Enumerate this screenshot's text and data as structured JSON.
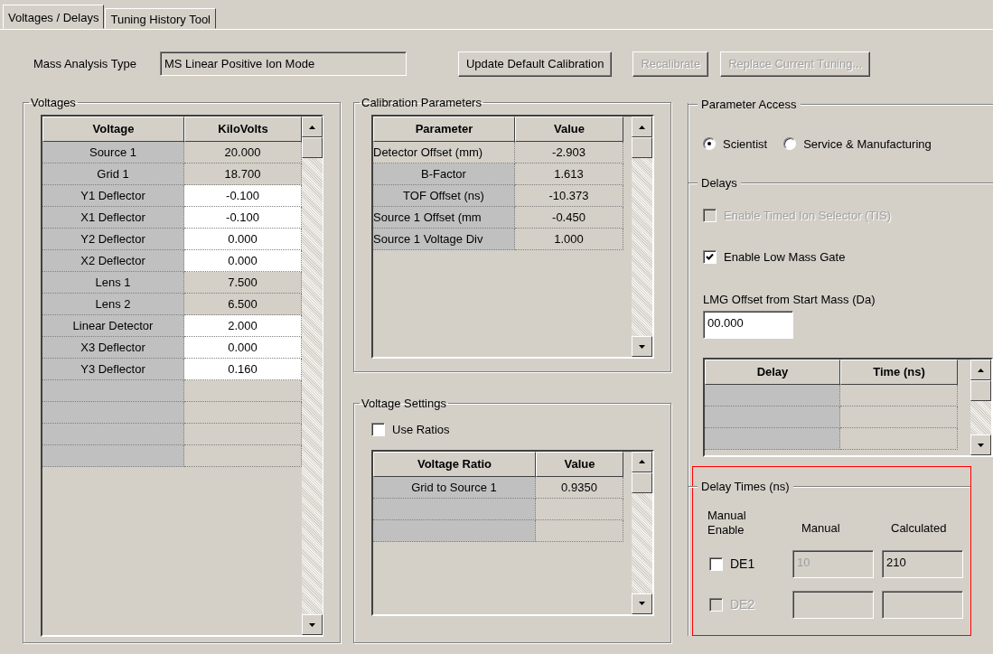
{
  "tabs": [
    {
      "label": "Voltages / Delays",
      "selected": true
    },
    {
      "label": "Tuning History Tool",
      "selected": false
    }
  ],
  "mass_analysis": {
    "label": "Mass Analysis Type",
    "value": "MS Linear Positive Ion Mode"
  },
  "buttons": [
    {
      "label": "Update Default Calibration",
      "disabled": false
    },
    {
      "label": "Recalibrate",
      "disabled": true
    },
    {
      "label": "Replace Current Tuning...",
      "disabled": true
    }
  ],
  "voltages": {
    "title": "Voltages",
    "columns": [
      "Voltage",
      "KiloVolts"
    ],
    "rows": [
      {
        "kind": "entry",
        "name": "Source 1",
        "value": "20.000",
        "editable": false
      },
      {
        "kind": "entry",
        "name": "Grid 1",
        "value": "18.700",
        "editable": false
      },
      {
        "kind": "entry",
        "name": "Y1 Deflector",
        "value": "-0.100",
        "editable": true
      },
      {
        "kind": "entry",
        "name": "X1 Deflector",
        "value": "-0.100",
        "editable": true
      },
      {
        "kind": "entry",
        "name": "Y2 Deflector",
        "value": "0.000",
        "editable": true
      },
      {
        "kind": "entry",
        "name": "X2 Deflector",
        "value": "0.000",
        "editable": true
      },
      {
        "kind": "entry",
        "name": "Lens 1",
        "value": "7.500",
        "editable": false
      },
      {
        "kind": "entry",
        "name": "Lens 2",
        "value": "6.500",
        "editable": false
      },
      {
        "kind": "entry",
        "name": "Linear Detector",
        "value": "2.000",
        "editable": true
      },
      {
        "kind": "entry",
        "name": "X3 Deflector",
        "value": "0.000",
        "editable": true
      },
      {
        "kind": "entry",
        "name": "Y3 Deflector",
        "value": "0.160",
        "editable": true
      },
      {
        "kind": "empty"
      },
      {
        "kind": "empty"
      },
      {
        "kind": "empty"
      },
      {
        "kind": "empty"
      }
    ]
  },
  "calibration": {
    "title": "Calibration Parameters",
    "columns": [
      "Parameter",
      "Value"
    ],
    "rows": [
      {
        "kind": "entry",
        "name": "Detector Offset (mm)",
        "value": "-2.903",
        "editable": false,
        "focused": true
      },
      {
        "kind": "entry",
        "name": "B-Factor",
        "value": "1.613",
        "editable": false,
        "focused": false
      },
      {
        "kind": "entry",
        "name": "TOF Offset (ns)",
        "value": "-10.373",
        "editable": false,
        "focused": false
      },
      {
        "kind": "entry",
        "name": "Source 1 Offset (mm",
        "value": "-0.450",
        "editable": false,
        "focused": false
      },
      {
        "kind": "entry",
        "name": "Source 1 Voltage Div",
        "value": "1.000",
        "editable": false,
        "focused": false
      }
    ]
  },
  "voltage_settings": {
    "title": "Voltage Settings",
    "use_ratios": {
      "label": "Use Ratios",
      "checked": false,
      "disabled": false
    },
    "table": {
      "columns": [
        "Voltage Ratio",
        "Value"
      ],
      "rows": [
        {
          "kind": "entry",
          "name": "Grid to Source 1",
          "value": "0.9350",
          "editable": false
        },
        {
          "kind": "empty"
        },
        {
          "kind": "empty"
        }
      ]
    }
  },
  "parameter_access": {
    "title": "Parameter Access",
    "options": [
      {
        "label": "Scientist",
        "selected": true
      },
      {
        "label": "Service & Manufacturing",
        "selected": false
      }
    ]
  },
  "delays": {
    "title": "Delays",
    "options": [
      {
        "label": "Enable Timed Ion Selector (TIS)",
        "checked": false,
        "disabled": true
      },
      {
        "label": "Enable Low Mass Gate",
        "checked": true,
        "disabled": false
      }
    ],
    "offset": {
      "label": "LMG Offset from Start Mass (Da)",
      "value": "00.000"
    },
    "table": {
      "columns": [
        "Delay",
        "Time (ns)"
      ],
      "rows": [
        {
          "kind": "empty"
        },
        {
          "kind": "empty"
        },
        {
          "kind": "empty"
        }
      ]
    }
  },
  "delay_times": {
    "title": "Delay Times (ns)",
    "highlighted": true,
    "columns": [
      "Manual Enable",
      "Manual",
      "Calculated"
    ],
    "rows": [
      {
        "label": "DE1",
        "checked": false,
        "disabled": false,
        "manual": "10",
        "manual_disabled": true,
        "calculated": "210"
      },
      {
        "label": "DE2",
        "checked": false,
        "disabled": true,
        "manual_disabled": false
      }
    ]
  }
}
